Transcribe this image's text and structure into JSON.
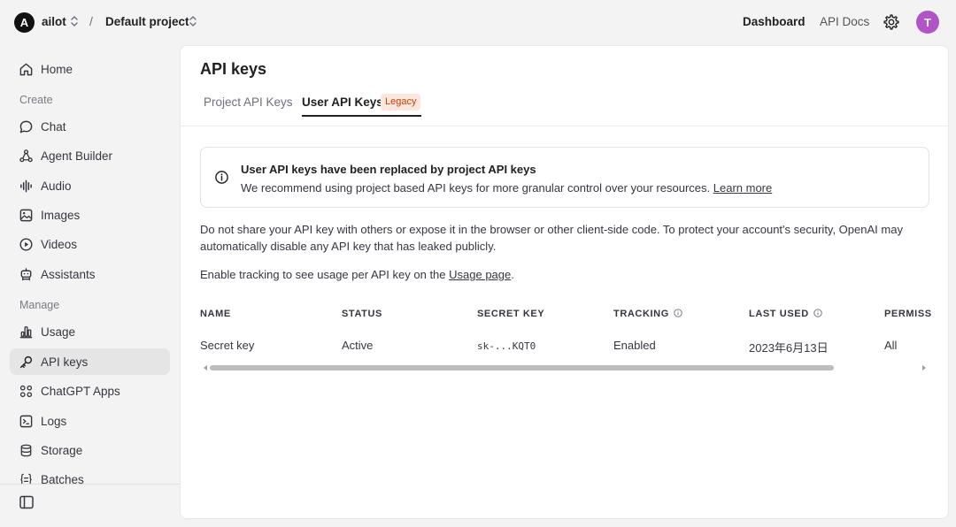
{
  "header": {
    "logo_letter": "A",
    "org_name": "ailot",
    "separator": "/",
    "project_name": "Default project",
    "nav_dashboard": "Dashboard",
    "nav_api_docs": "API Docs",
    "avatar_letter": "T",
    "avatar_color": "#b154c7"
  },
  "sidebar": {
    "home": "Home",
    "section_create": "Create",
    "chat": "Chat",
    "agent_builder": "Agent Builder",
    "audio": "Audio",
    "images": "Images",
    "videos": "Videos",
    "assistants": "Assistants",
    "section_manage": "Manage",
    "usage": "Usage",
    "api_keys": "API keys",
    "chatgpt_apps": "ChatGPT Apps",
    "logs": "Logs",
    "storage": "Storage",
    "batches": "Batches",
    "active_item": "API keys"
  },
  "main": {
    "title": "API keys",
    "tab_project": "Project API Keys",
    "tab_user": "User API Keys",
    "legacy_badge": "Legacy",
    "notice_title": "User API keys have been replaced by project API keys",
    "notice_body": "We recommend using project based API keys for more granular control over your resources.",
    "notice_link": "Learn more",
    "warning": "Do not share your API key with others or expose it in the browser or other client-side code. To protect your account's security, OpenAI may automatically disable any API key that has leaked publicly.",
    "tracking_prefix": "Enable tracking to see usage per API key on the",
    "tracking_link": "Usage page",
    "tracking_suffix": "."
  },
  "table": {
    "headers": {
      "name": "NAME",
      "status": "STATUS",
      "secret_key": "SECRET KEY",
      "tracking": "TRACKING",
      "last_used": "LAST USED",
      "permissions": "PERMISS"
    },
    "rows": [
      {
        "name": "Secret key",
        "status": "Active",
        "secret_key": "sk-...KQT0",
        "tracking": "Enabled",
        "last_used": "2023年6月13日",
        "permissions": "All"
      }
    ]
  },
  "colors": {
    "legacy_badge_bg": "#fde6db",
    "legacy_badge_text": "#c2410c"
  }
}
